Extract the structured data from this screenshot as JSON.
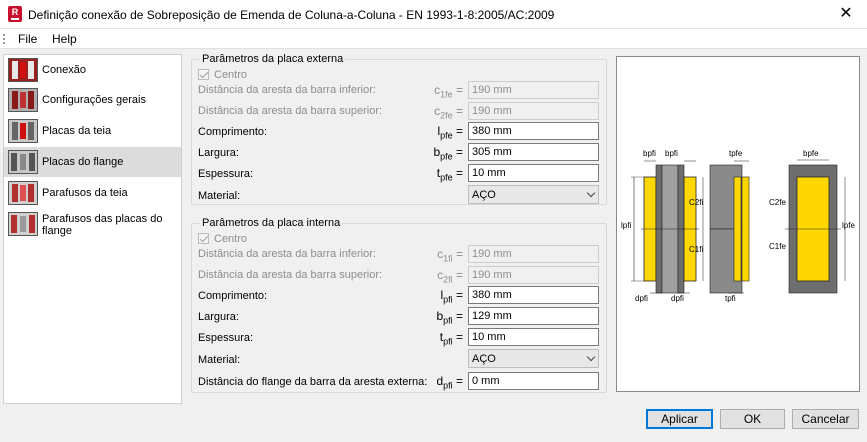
{
  "window": {
    "title": "Definição conexão de Sobreposição de Emenda de Coluna-a-Coluna - EN 1993-1-8:2005/AC:2009",
    "app_icon_letter": "R",
    "close_glyph": "✕"
  },
  "menu": {
    "file": "File",
    "help": "Help"
  },
  "sidebar": {
    "items": [
      {
        "label": "Conexão"
      },
      {
        "label": "Configurações gerais"
      },
      {
        "label": "Placas da teia"
      },
      {
        "label": "Placas do flange"
      },
      {
        "label": "Parafusos da teia"
      },
      {
        "label": "Parafusos das placas do flange"
      }
    ],
    "selected": "Placas do flange"
  },
  "outer": {
    "legend": "Parâmetros da placa externa",
    "center_label": "Centro",
    "rows": [
      {
        "label": "Distância da aresta da barra inferior:",
        "sym": "c",
        "sub": "1fe",
        "eq": "=",
        "value": "190 mm",
        "disabled": true
      },
      {
        "label": "Distância da aresta da barra superior:",
        "sym": "c",
        "sub": "2fe",
        "eq": "=",
        "value": "190 mm",
        "disabled": true
      },
      {
        "label": "Comprimento:",
        "sym": "l",
        "sub": "pfe",
        "eq": "=",
        "value": "380 mm",
        "disabled": false
      },
      {
        "label": "Largura:",
        "sym": "b",
        "sub": "pfe",
        "eq": "=",
        "value": "305 mm",
        "disabled": false
      },
      {
        "label": "Espessura:",
        "sym": "t",
        "sub": "pfe",
        "eq": "=",
        "value": "10 mm",
        "disabled": false
      }
    ],
    "material_label": "Material:",
    "material_value": "AÇO"
  },
  "inner": {
    "legend": "Parâmetros da placa interna",
    "center_label": "Centro",
    "rows": [
      {
        "label": "Distância da aresta da barra inferior:",
        "sym": "c",
        "sub": "1fi",
        "eq": "=",
        "value": "190 mm",
        "disabled": true
      },
      {
        "label": "Distância da aresta da barra superior:",
        "sym": "c",
        "sub": "2fi",
        "eq": "=",
        "value": "190 mm",
        "disabled": true
      },
      {
        "label": "Comprimento:",
        "sym": "l",
        "sub": "pfi",
        "eq": "=",
        "value": "380 mm",
        "disabled": false
      },
      {
        "label": "Largura:",
        "sym": "b",
        "sub": "pfi",
        "eq": "=",
        "value": "129 mm",
        "disabled": false
      },
      {
        "label": "Espessura:",
        "sym": "t",
        "sub": "pfi",
        "eq": "=",
        "value": "10 mm",
        "disabled": false
      }
    ],
    "material_label": "Material:",
    "material_value": "AÇO",
    "flange_row": {
      "label": "Distância do flange da barra da aresta externa:",
      "sym": "d",
      "sub": "pfi",
      "eq": "=",
      "value": "0 mm"
    }
  },
  "diagram": {
    "labels": {
      "bpfi_a": "bpfi",
      "bpfi_b": "bpfi",
      "lpfi": "lpfi",
      "c2fi": "C2fi",
      "c1fi": "C1fi",
      "dpfi_a": "dpfi",
      "dpfi_b": "dpfi",
      "tpfe": "tpfe",
      "tpfi": "tpfi",
      "bpfe": "bpfe",
      "c2fe": "C2fe",
      "c1fe": "C1fe",
      "lpfe": "lpfe"
    },
    "colors": {
      "plate": "#ffd700",
      "section": "#6e6e6e",
      "section_light": "#a0a0a0"
    }
  },
  "buttons": {
    "apply": "Aplicar",
    "ok": "OK",
    "cancel": "Cancelar"
  }
}
